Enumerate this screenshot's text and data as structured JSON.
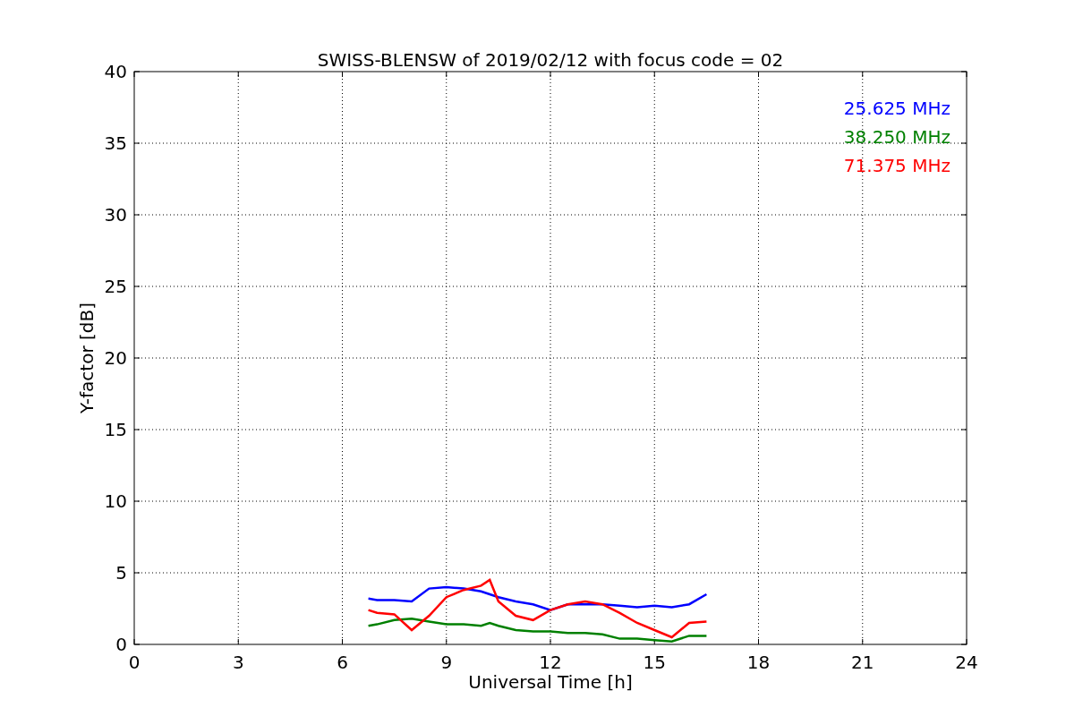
{
  "chart_data": {
    "type": "line",
    "title": "SWISS-BLENSW of 2019/02/12 with focus code = 02",
    "xlabel": "Universal Time [h]",
    "ylabel": "Y-factor [dB]",
    "x": [
      6.75,
      7,
      7.5,
      8,
      8.5,
      9,
      9.5,
      10,
      10.25,
      10.5,
      11,
      11.5,
      12,
      12.5,
      13,
      13.5,
      14,
      14.5,
      15,
      15.5,
      16,
      16.5
    ],
    "series": [
      {
        "name": "25.625 MHz",
        "color": "#0000ff",
        "values": [
          3.2,
          3.1,
          3.1,
          3.0,
          3.9,
          4.0,
          3.9,
          3.7,
          3.5,
          3.3,
          3.0,
          2.8,
          2.4,
          2.8,
          2.8,
          2.8,
          2.7,
          2.6,
          2.7,
          2.6,
          2.8,
          3.5
        ]
      },
      {
        "name": "38.250 MHz",
        "color": "#008000",
        "values": [
          1.3,
          1.4,
          1.7,
          1.8,
          1.6,
          1.4,
          1.4,
          1.3,
          1.5,
          1.3,
          1.0,
          0.9,
          0.9,
          0.8,
          0.8,
          0.7,
          0.4,
          0.4,
          0.3,
          0.2,
          0.6,
          0.6
        ]
      },
      {
        "name": "71.375 MHz",
        "color": "#ff0000",
        "values": [
          2.4,
          2.2,
          2.1,
          1.0,
          2.0,
          3.3,
          3.8,
          4.1,
          4.5,
          3.0,
          2.0,
          1.7,
          2.4,
          2.8,
          3.0,
          2.8,
          2.2,
          1.5,
          1.0,
          0.5,
          1.5,
          1.6
        ]
      }
    ],
    "xlim": [
      0,
      24
    ],
    "ylim": [
      0,
      40
    ],
    "xticks": [
      0,
      3,
      6,
      9,
      12,
      15,
      18,
      21,
      24
    ],
    "yticks": [
      0,
      5,
      10,
      15,
      20,
      25,
      30,
      35,
      40
    ],
    "grid": true
  }
}
